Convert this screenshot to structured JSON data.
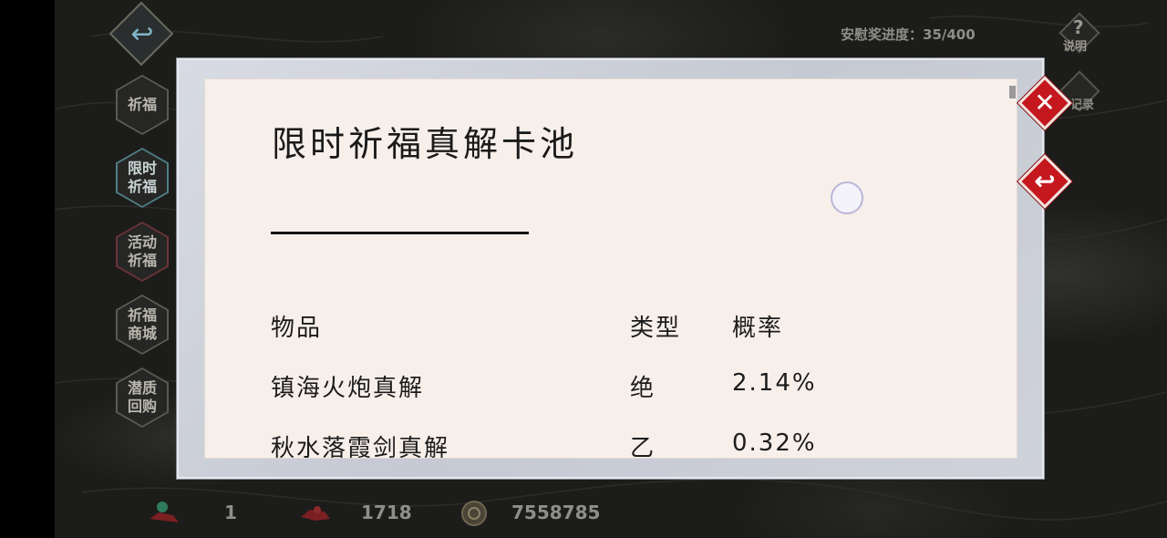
{
  "top_bar": {
    "back_icon": "back-arrow-icon",
    "progress_label": "安慰奖进度：35/400",
    "help_label": "说明",
    "record_label": "记录"
  },
  "side_menu": {
    "items": [
      {
        "label": "祈福",
        "state": "normal"
      },
      {
        "label": "限时祈福",
        "state": "active"
      },
      {
        "label": "活动祈福",
        "state": "highlight"
      },
      {
        "label": "祈福商城",
        "state": "normal"
      },
      {
        "label": "潜质回购",
        "state": "normal"
      }
    ]
  },
  "currency": {
    "items": [
      {
        "icon": "lantern-token-icon",
        "value": "1"
      },
      {
        "icon": "red-token-icon",
        "value": "1718"
      },
      {
        "icon": "coin-icon",
        "value": "7558785"
      }
    ]
  },
  "modal": {
    "title": "限时祈福真解卡池",
    "close_icon": "close-x-icon",
    "return_icon": "return-arrow-icon",
    "table": {
      "headers": [
        "物品",
        "类型",
        "概率"
      ],
      "rows": [
        [
          "镇海火炮真解",
          "绝",
          "2.14%"
        ],
        [
          "秋水落霞剑真解",
          "乙",
          "0.32%"
        ]
      ]
    }
  },
  "colors": {
    "accent_red": "#c4171e",
    "paper": "#f7efea",
    "frame": "#d3d6de",
    "active_teal": "#4e7f86"
  }
}
